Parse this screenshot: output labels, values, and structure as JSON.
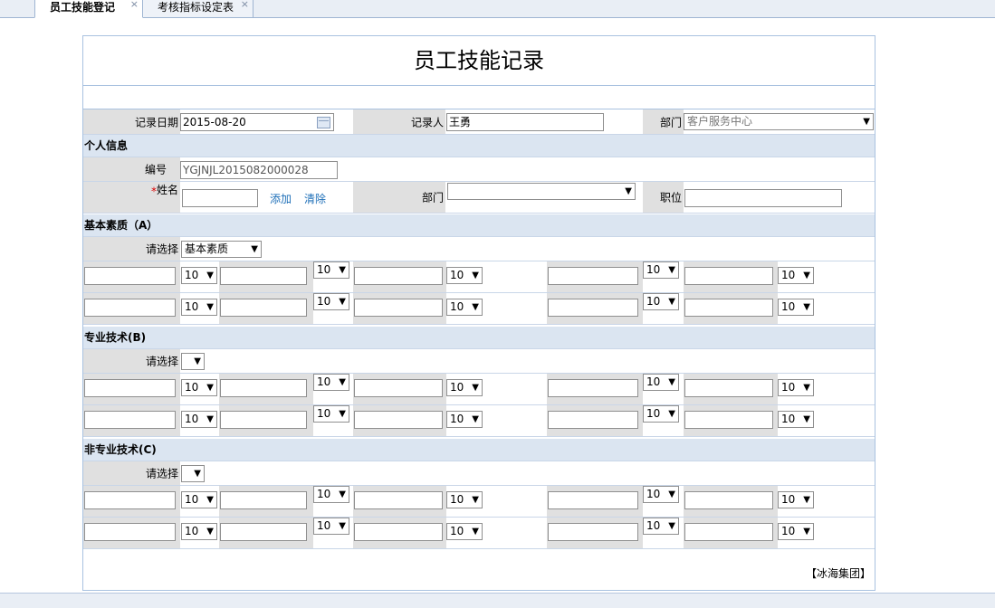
{
  "tabs": [
    {
      "label": "员工技能登记"
    },
    {
      "label": "考核指标设定表"
    }
  ],
  "close_glyph": "×",
  "form": {
    "title": "员工技能记录",
    "record_date_label": "记录日期",
    "record_date_value": "2015-08-20",
    "recorder_label": "记录人",
    "recorder_value": "王勇",
    "dept_label": "部门",
    "dept_value": "客户服务中心",
    "personal_section": "个人信息",
    "code_label": "编号",
    "code_value": "YGJNJL2015082000028",
    "name_label": "姓名",
    "required_mark": "*",
    "add_link": "添加",
    "clear_link": "清除",
    "dept2_label": "部门",
    "position_label": "职位",
    "footer": "【冰海集团】"
  },
  "sections": [
    {
      "title": "基本素质（A）",
      "choose_label": "请选择",
      "choose_value": "基本素质"
    },
    {
      "title": "专业技术(B)",
      "choose_label": "请选择",
      "choose_value": ""
    },
    {
      "title": "非专业技术(C)",
      "choose_label": "请选择",
      "choose_value": ""
    }
  ],
  "score_default": "10",
  "dropdown_arrow": "▼"
}
